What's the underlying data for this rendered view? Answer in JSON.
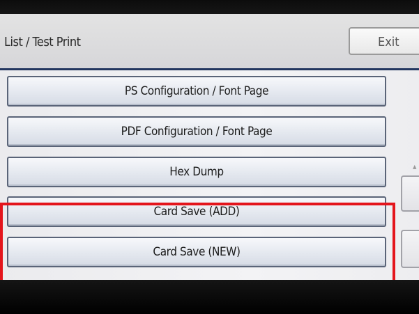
{
  "header": {
    "title": "List / Test Print",
    "exit_label": "Exit"
  },
  "menu": {
    "items": [
      {
        "label": "PS Configuration / Font Page"
      },
      {
        "label": "PDF Configuration / Font Page"
      },
      {
        "label": "Hex Dump"
      },
      {
        "label": "Card Save (ADD)"
      },
      {
        "label": "Card Save (NEW)"
      }
    ]
  },
  "annotation": {
    "highlight_color": "#e4151c",
    "highlighted_items": [
      "Card Save (ADD)",
      "Card Save (NEW)"
    ]
  },
  "colors": {
    "header_underline": "#23365f",
    "button_border": "#5a6478"
  }
}
